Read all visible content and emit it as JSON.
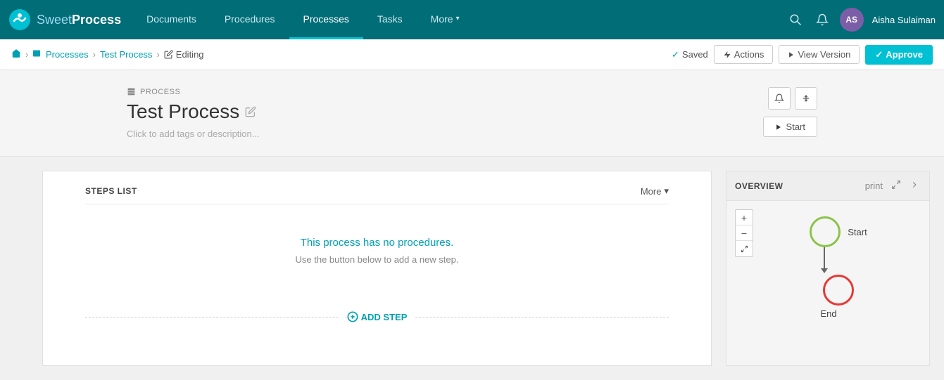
{
  "app": {
    "name_sweet": "Sweet",
    "name_process": "Process"
  },
  "topnav": {
    "links": [
      {
        "id": "documents",
        "label": "Documents",
        "active": false
      },
      {
        "id": "procedures",
        "label": "Procedures",
        "active": false
      },
      {
        "id": "processes",
        "label": "Processes",
        "active": true
      },
      {
        "id": "tasks",
        "label": "Tasks",
        "active": false
      },
      {
        "id": "more",
        "label": "More",
        "has_chevron": true,
        "active": false
      }
    ],
    "search_icon": "🔍",
    "bell_icon": "🔔",
    "avatar_initials": "AS",
    "user_name": "Aisha Sulaiman"
  },
  "breadcrumb": {
    "home_icon": "🏠",
    "processes_label": "Processes",
    "process_name": "Test Process",
    "editing_icon": "✏",
    "editing_label": "Editing"
  },
  "breadcrumb_actions": {
    "saved_check": "✓",
    "saved_label": "Saved",
    "actions_icon": "⚡",
    "actions_label": "Actions",
    "view_version_icon": "▶",
    "view_version_label": "View Version",
    "approve_check": "✓",
    "approve_label": "Approve"
  },
  "process_header": {
    "process_icon": "📋",
    "process_type": "PROCESS",
    "title": "Test Process",
    "edit_icon": "✏",
    "tag_placeholder": "Click to add tags or description...",
    "bell_icon": "🔔",
    "settings_icon": "⇅",
    "start_icon": "▶",
    "start_label": "Start"
  },
  "steps_list": {
    "title": "STEPS LIST",
    "more_label": "More",
    "chevron": "▾",
    "empty_main": "This process has no procedures.",
    "empty_sub": "Use the button below to add a new step.",
    "add_step_plus": "⊕",
    "add_step_label": "ADD STEP"
  },
  "overview": {
    "title": "OVERVIEW",
    "print_label": "print",
    "expand_icon": "⛶",
    "arrow_icon": "›",
    "zoom_plus": "+",
    "zoom_minus": "−",
    "zoom_fit": "⛶",
    "start_label": "Start",
    "end_label": "End"
  }
}
